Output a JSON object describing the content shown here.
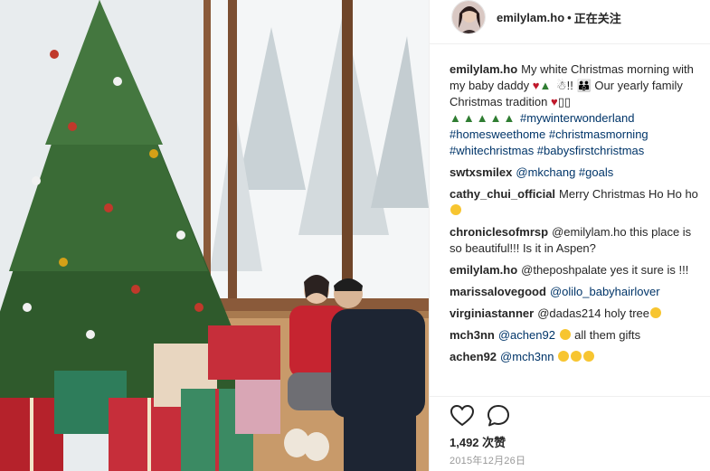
{
  "header": {
    "username": "emilylam.ho",
    "separator": "•",
    "follow_status": "正在关注"
  },
  "caption": {
    "username": "emilylam.ho",
    "text_a": "My white Christmas morning with my baby daddy",
    "text_b": "!! ",
    "text_c": "Our yearly family Christmas tradition",
    "hashtags": "#mywinterwonderland #homesweethome #christmasmorning #whitechristmas #babysfirstchristmas"
  },
  "comments": [
    {
      "user": "swtxsmilex",
      "text": "@mkchang #goals"
    },
    {
      "user": "cathy_chui_official",
      "text": "Merry Christmas Ho Ho ho"
    },
    {
      "user": "chroniclesofmrsp",
      "text": "@emilylam.ho this place is so beautiful!!! Is it in Aspen?"
    },
    {
      "user": "emilylam.ho",
      "text": "@theposhpalate yes it sure is !!!"
    },
    {
      "user": "marissalovegood",
      "text": "@olilo_babyhairlover"
    },
    {
      "user": "virginiastanner",
      "text": "@dadas214 holy tree"
    },
    {
      "user": "mch3nn",
      "text": "@achen92",
      "text2": "all them gifts"
    },
    {
      "user": "achen92",
      "text": "@mch3nn"
    }
  ],
  "actions": {
    "like_icon": "heart-outline-icon",
    "comment_icon": "comment-bubble-icon"
  },
  "likes": {
    "count": "1,492",
    "label": "次赞"
  },
  "date": "2015年12月26日",
  "colors": {
    "link": "#003569",
    "text": "#262626",
    "muted": "#999999",
    "divider": "#efefef"
  }
}
